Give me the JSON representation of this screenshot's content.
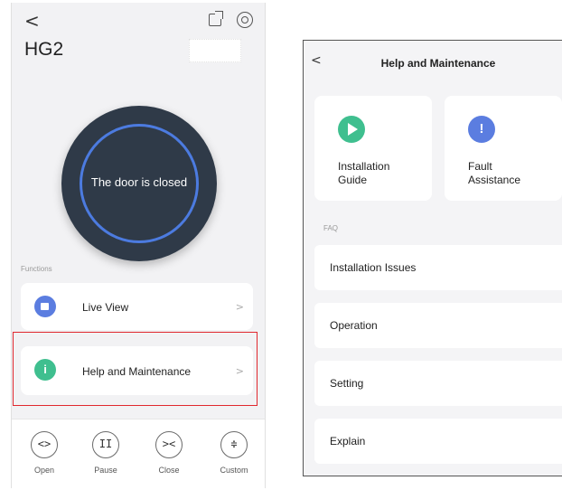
{
  "left_screen": {
    "back_glyph": "<",
    "title": "HG2",
    "dial_text": "The door is closed",
    "functions_label": "Functions",
    "cards": [
      {
        "label": "Live View",
        "chevron": ">"
      },
      {
        "label": "Help and Maintenance",
        "icon_glyph": "i",
        "chevron": ">"
      }
    ],
    "controls": [
      {
        "glyph": "<>",
        "label": "Open"
      },
      {
        "glyph": "II",
        "label": "Pause"
      },
      {
        "glyph": "><",
        "label": "Close"
      },
      {
        "glyph": "≑",
        "label": "Custom"
      }
    ],
    "highlight_color": "#e0282f"
  },
  "right_screen": {
    "back_glyph": "<",
    "title": "Help and Maintenance",
    "tiles": [
      {
        "label": "Installation\nGuide",
        "icon": "play-icon",
        "color": "#3fbf8f"
      },
      {
        "label": "Fault\nAssistance",
        "icon_glyph": "!",
        "icon": "exclamation-icon",
        "color": "#5b7de0"
      }
    ],
    "faq_label": "FAQ",
    "faq_items": [
      "Installation Issues",
      "Operation",
      "Setting",
      "Explain"
    ]
  }
}
